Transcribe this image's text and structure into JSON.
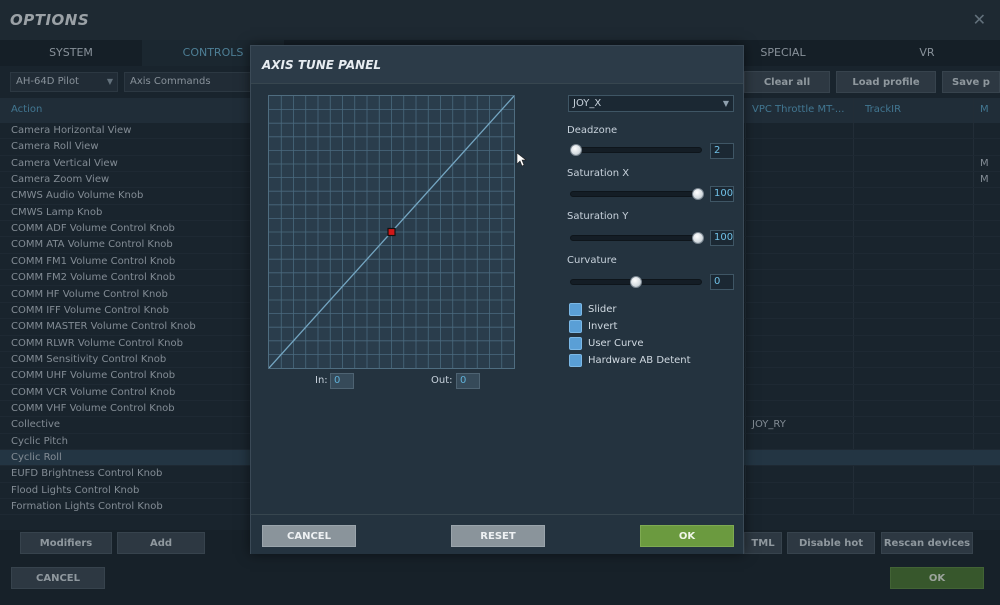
{
  "window": {
    "title": "OPTIONS",
    "close_glyph": "✕"
  },
  "tabs": [
    "SYSTEM",
    "CONTROLS",
    "SPECIAL",
    "VR"
  ],
  "toolbar": {
    "aircraft": "AH-64D Pilot",
    "category": "Axis Commands",
    "clear_all": "Clear all",
    "load_profile": "Load profile",
    "save_profile": "Save p"
  },
  "table": {
    "header_action": "Action",
    "header_device1": "VPC Throttle MT-...",
    "header_device2": "TrackIR",
    "header_far": "M",
    "rows": [
      {
        "label": "Camera Horizontal View",
        "far": ""
      },
      {
        "label": "Camera Roll View",
        "far": ""
      },
      {
        "label": "Camera Vertical View",
        "far": "M"
      },
      {
        "label": "Camera Zoom View",
        "far": "M"
      },
      {
        "label": "CMWS Audio Volume Knob",
        "far": ""
      },
      {
        "label": "CMWS Lamp Knob",
        "far": ""
      },
      {
        "label": "COMM ADF Volume Control Knob",
        "far": ""
      },
      {
        "label": "COMM ATA Volume Control Knob",
        "far": ""
      },
      {
        "label": "COMM FM1 Volume Control Knob",
        "far": ""
      },
      {
        "label": "COMM FM2 Volume Control Knob",
        "far": ""
      },
      {
        "label": "COMM HF Volume Control Knob",
        "far": ""
      },
      {
        "label": "COMM IFF Volume Control Knob",
        "far": ""
      },
      {
        "label": "COMM MASTER Volume Control Knob",
        "far": ""
      },
      {
        "label": "COMM RLWR Volume Control Knob",
        "far": ""
      },
      {
        "label": "COMM Sensitivity Control Knob",
        "far": ""
      },
      {
        "label": "COMM UHF Volume Control Knob",
        "far": ""
      },
      {
        "label": "COMM VCR Volume Control Knob",
        "far": ""
      },
      {
        "label": "COMM VHF Volume Control Knob",
        "far": ""
      },
      {
        "label": "Collective",
        "device1": "JOY_RY",
        "far": ""
      },
      {
        "label": "Cyclic Pitch",
        "far": ""
      },
      {
        "label": "Cyclic Roll",
        "far": "",
        "selected": true
      },
      {
        "label": "EUFD Brightness Control Knob",
        "far": ""
      },
      {
        "label": "Flood Lights Control Knob",
        "far": ""
      },
      {
        "label": "Formation Lights Control Knob",
        "far": ""
      }
    ]
  },
  "bottom_buttons": {
    "modifiers": "Modifiers",
    "add": "Add",
    "html": "TML",
    "disable_hot_plug": "Disable hot plug",
    "rescan_devices": "Rescan devices"
  },
  "footer": {
    "cancel": "CANCEL",
    "ok": "OK"
  },
  "modal": {
    "title": "AXIS TUNE PANEL",
    "axis": "JOY_X",
    "in_label": "In:",
    "in_value": "0",
    "out_label": "Out:",
    "out_value": "0",
    "deadzone_label": "Deadzone",
    "deadzone_value": "2",
    "saturation_x_label": "Saturation X",
    "saturation_x_value": "100",
    "saturation_y_label": "Saturation Y",
    "saturation_y_value": "100",
    "curvature_label": "Curvature",
    "curvature_value": "0",
    "checkboxes": [
      "Slider",
      "Invert",
      "User Curve",
      "Hardware AB Detent"
    ],
    "cancel": "CANCEL",
    "reset": "RESET",
    "ok": "OK"
  },
  "chart_data": {
    "type": "line",
    "x": [
      -100,
      100
    ],
    "y": [
      -100,
      100
    ],
    "marker_input": 0,
    "marker_output": 0,
    "xlim": [
      -100,
      100
    ],
    "ylim": [
      -100,
      100
    ],
    "grid": true,
    "title": "",
    "xlabel": "",
    "ylabel": ""
  },
  "colors": {
    "accent": "#5da9cf",
    "ok_green": "#6b9a3f",
    "curve": "#74a6c2",
    "grid": "#4a6a7e",
    "marker": "#d01818"
  }
}
